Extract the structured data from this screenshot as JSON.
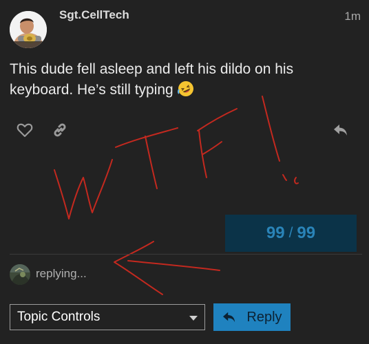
{
  "post": {
    "username": "Sgt.CellTech",
    "age": "1m",
    "body": "This dude fell asleep and left his dildo on his keyboard. He’s still typing",
    "emoji": "rolling-on-the-floor-laughing-emoji",
    "avatar": "wrestler-with-championship-belt-avatar"
  },
  "actions": {
    "like": "heart-icon",
    "link": "link-icon",
    "reply": "reply-arrow-icon"
  },
  "progress": {
    "current": "99",
    "separator": "/",
    "total": "99"
  },
  "presence": {
    "text": "replying...",
    "avatar": "game-screenshot-avatar"
  },
  "footer": {
    "topic_controls_label": "Topic Controls",
    "reply_label": "Reply"
  },
  "annotation": {
    "handwritten_text": "WTF!",
    "color": "#c4291f"
  },
  "colors": {
    "background": "#222222",
    "progress_bg": "#0b3348",
    "progress_text": "#2a84b8",
    "primary_button": "#1f82bf"
  }
}
